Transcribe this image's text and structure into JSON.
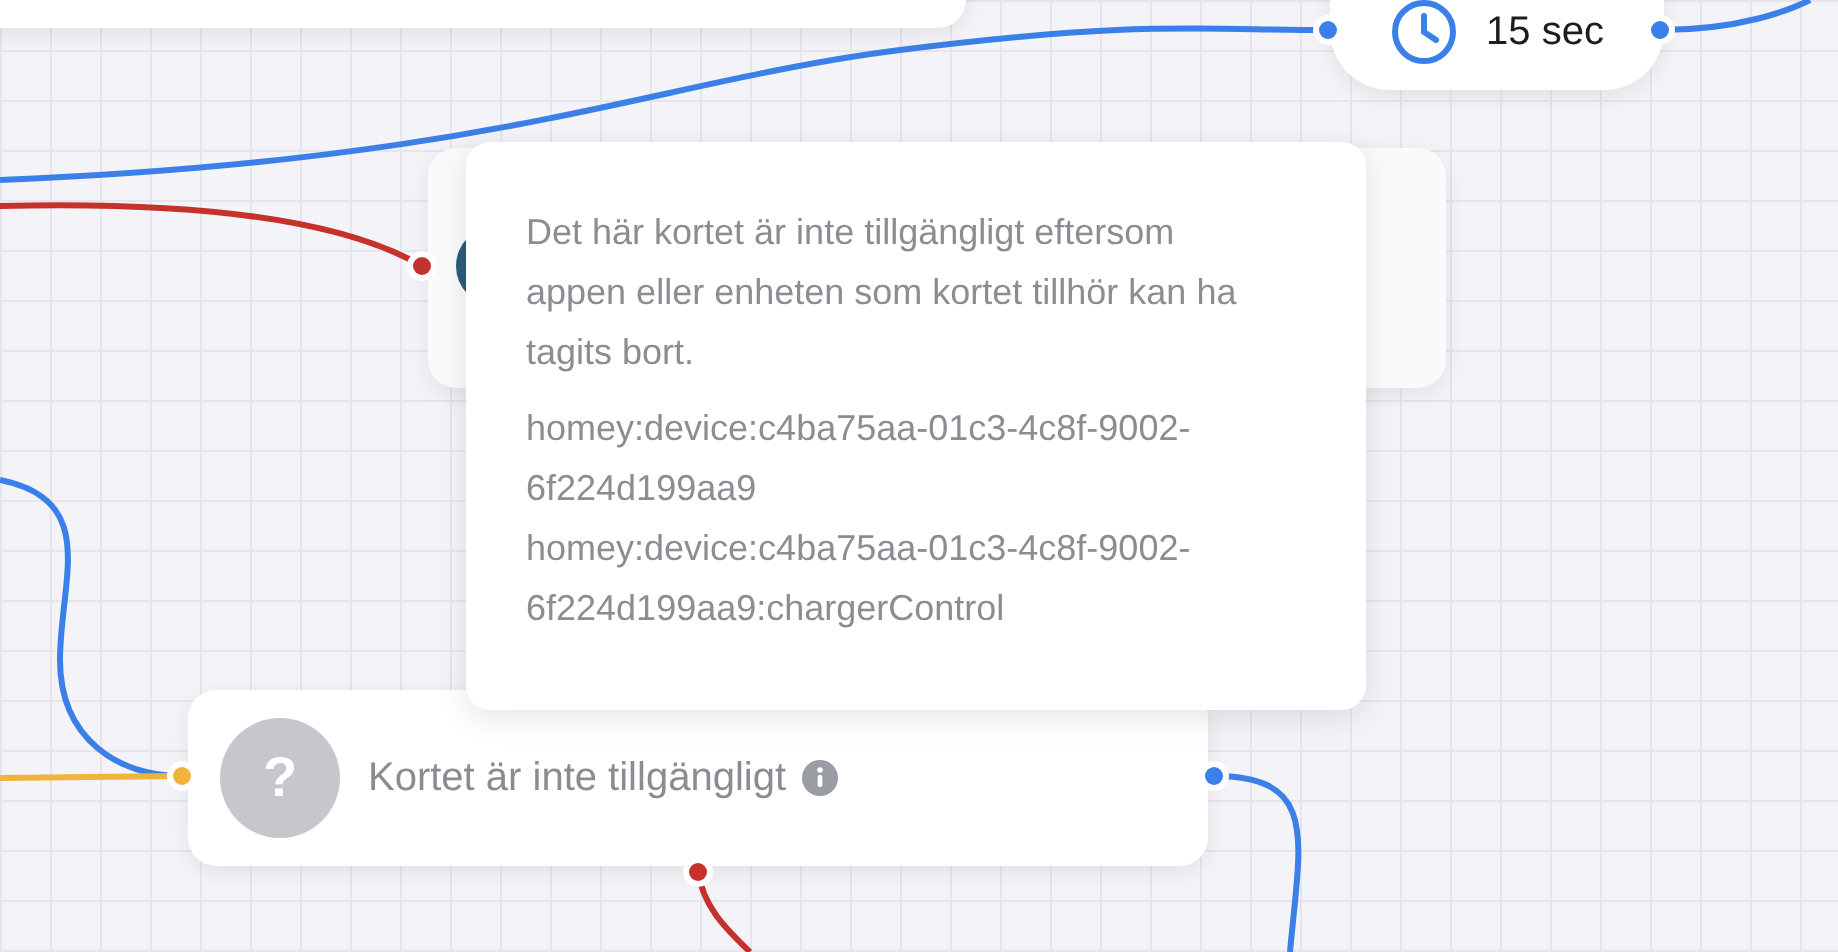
{
  "delay_card": {
    "text": "15 sec"
  },
  "tooltip": {
    "message": "Det här kortet är inte tillgängligt eftersom appen eller enheten som kortet tillhör kan ha tagits bort.",
    "ids": [
      "homey:device:c4ba75aa-01c3-4c8f-9002-6f224d199aa9",
      "homey:device:c4ba75aa-01c3-4c8f-9002-6f224d199aa9:chargerControl"
    ]
  },
  "unavailable_card": {
    "icon": "?",
    "title": "Kortet är inte tillgängligt"
  },
  "wires": [
    {
      "color": "#3b7fe8"
    },
    {
      "color": "#3b7fe8"
    },
    {
      "color": "#c4322b"
    },
    {
      "color": "#3b7fe8"
    },
    {
      "color": "#f0b33c"
    },
    {
      "color": "#3b7fe8"
    },
    {
      "color": "#c4322b"
    }
  ]
}
